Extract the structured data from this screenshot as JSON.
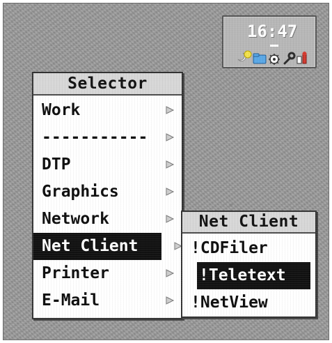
{
  "selector_menu": {
    "title": "Selector",
    "items": [
      {
        "label": "Work",
        "submenu": true
      },
      {
        "label": "-----------",
        "submenu": true
      },
      {
        "label": "DTP",
        "submenu": true
      },
      {
        "label": "Graphics",
        "submenu": true
      },
      {
        "label": "Network",
        "submenu": true
      },
      {
        "label": "Net Client",
        "submenu": true,
        "selected": true
      },
      {
        "label": "Printer",
        "submenu": true
      },
      {
        "label": "E-Mail",
        "submenu": true
      }
    ]
  },
  "net_client_menu": {
    "title": "Net Client",
    "items": [
      {
        "label": "!CDFiler"
      },
      {
        "label": "!Teletext",
        "selected": true
      },
      {
        "label": "!NetView"
      }
    ]
  },
  "clock_widget": {
    "time": "16:47",
    "icons": [
      "moon-icon",
      "folder-icon",
      "gear-icon",
      "wrench-icon",
      "tools-icon"
    ]
  },
  "colors": {
    "desktop": "#9a9a9a",
    "menu_bg": "#ffffff",
    "menu_title_bg": "#d7d7d7",
    "selected_bg": "#111111",
    "selected_fg": "#ffffff",
    "accent_yellow": "#f3e24c",
    "accent_blue": "#5aa8e6",
    "accent_red": "#d43a2f"
  }
}
